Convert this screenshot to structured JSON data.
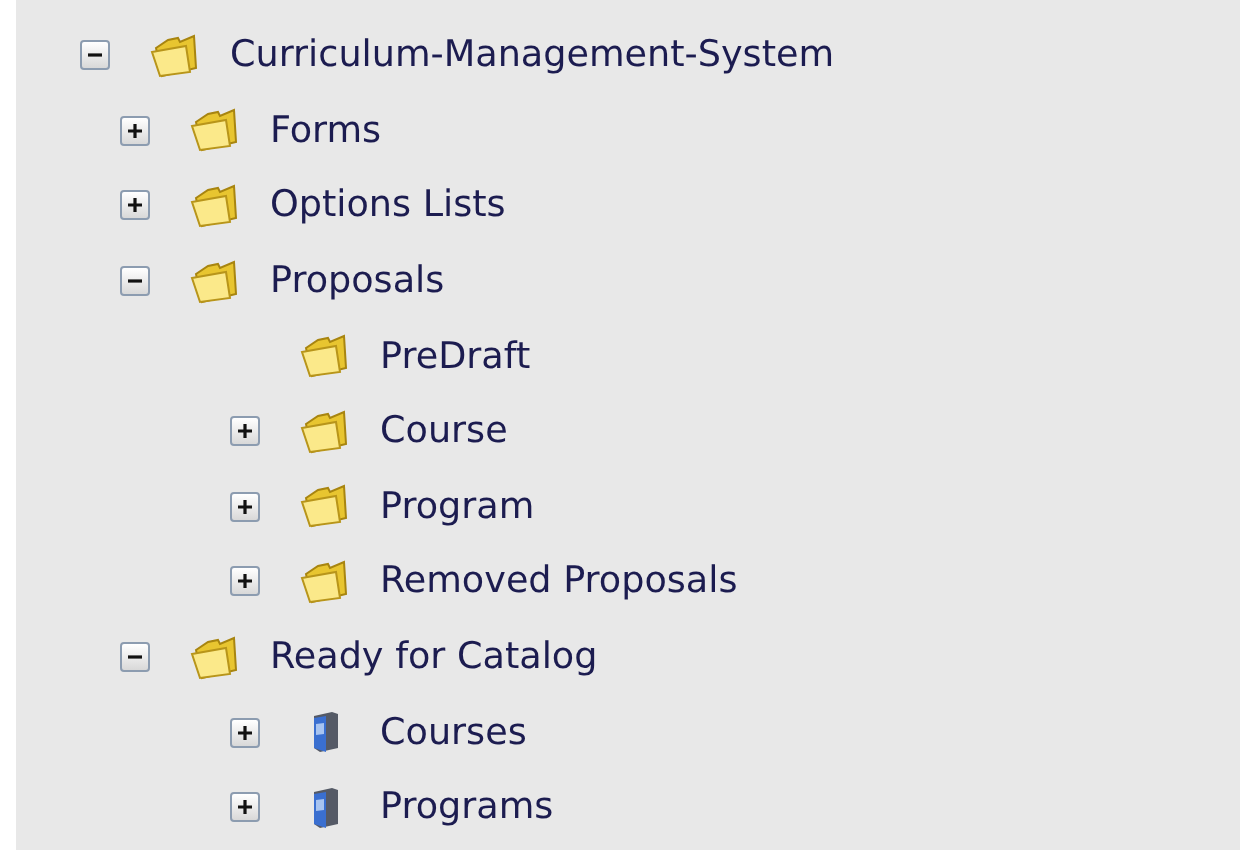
{
  "tree": [
    {
      "label": "Curriculum-Management-System",
      "kind": "folder",
      "expanded": true,
      "children": [
        {
          "label": "Forms",
          "kind": "folder",
          "expanded": false
        },
        {
          "label": "Options Lists",
          "kind": "folder",
          "expanded": false
        },
        {
          "label": "Proposals",
          "kind": "folder",
          "expanded": true,
          "children": [
            {
              "label": "PreDraft",
              "kind": "folder"
            },
            {
              "label": "Course",
              "kind": "folder",
              "expanded": false
            },
            {
              "label": "Program",
              "kind": "folder",
              "expanded": false
            },
            {
              "label": "Removed Proposals",
              "kind": "folder",
              "expanded": false
            }
          ]
        },
        {
          "label": "Ready for Catalog",
          "kind": "folder",
          "expanded": true,
          "children": [
            {
              "label": "Courses",
              "kind": "binder",
              "expanded": false
            },
            {
              "label": "Programs",
              "kind": "binder",
              "expanded": false
            }
          ]
        }
      ]
    }
  ]
}
